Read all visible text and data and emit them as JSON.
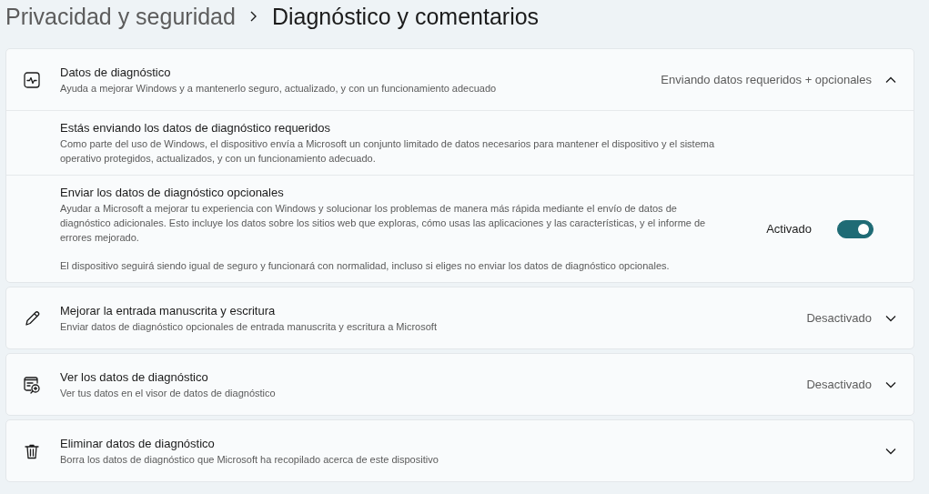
{
  "breadcrumb": {
    "parent": "Privacidad y seguridad",
    "current": "Diagnóstico y comentarios"
  },
  "sections": [
    {
      "kind": "pulse",
      "title": "Datos de diagnóstico",
      "description": "Ayuda a mejorar Windows y a mantenerlo seguro, actualizado, y con un funcionamiento adecuado",
      "status": "Enviando datos requeridos + opcionales",
      "expanded": true,
      "items": [
        {
          "kind": "info",
          "title": "Estás enviando los datos de diagnóstico requeridos",
          "description": "Como parte del uso de Windows, el dispositivo envía a Microsoft un conjunto limitado de datos necesarios para mantener el dispositivo y el sistema operativo protegidos, actualizados, y con un funcionamiento adecuado."
        },
        {
          "kind": "toggle",
          "title": "Enviar los datos de diagnóstico opcionales",
          "description": "Ayudar a Microsoft a mejorar tu experiencia con Windows y solucionar los problemas de manera más rápida mediante el envío de datos de diagnóstico adicionales. Esto incluye los datos sobre los sitios web que exploras, cómo usas las aplicaciones y las características, y el informe de errores mejorado.",
          "note": "El dispositivo seguirá siendo igual de seguro y funcionará con normalidad, incluso si eliges no enviar los datos de diagnóstico opcionales.",
          "toggle_label": "Activado",
          "on": true
        }
      ]
    },
    {
      "kind": "pen",
      "title": "Mejorar la entrada manuscrita y escritura",
      "description": "Enviar datos de diagnóstico opcionales de entrada manuscrita y escritura a Microsoft",
      "status": "Desactivado",
      "expanded": false
    },
    {
      "kind": "viewer",
      "title": "Ver los datos de diagnóstico",
      "description": "Ver tus datos en el visor de datos de diagnóstico",
      "status": "Desactivado",
      "expanded": false
    },
    {
      "kind": "trash",
      "title": "Eliminar datos de diagnóstico",
      "description": "Borra los datos de diagnóstico que Microsoft ha recopilado acerca de este dispositivo",
      "expanded": false
    }
  ]
}
